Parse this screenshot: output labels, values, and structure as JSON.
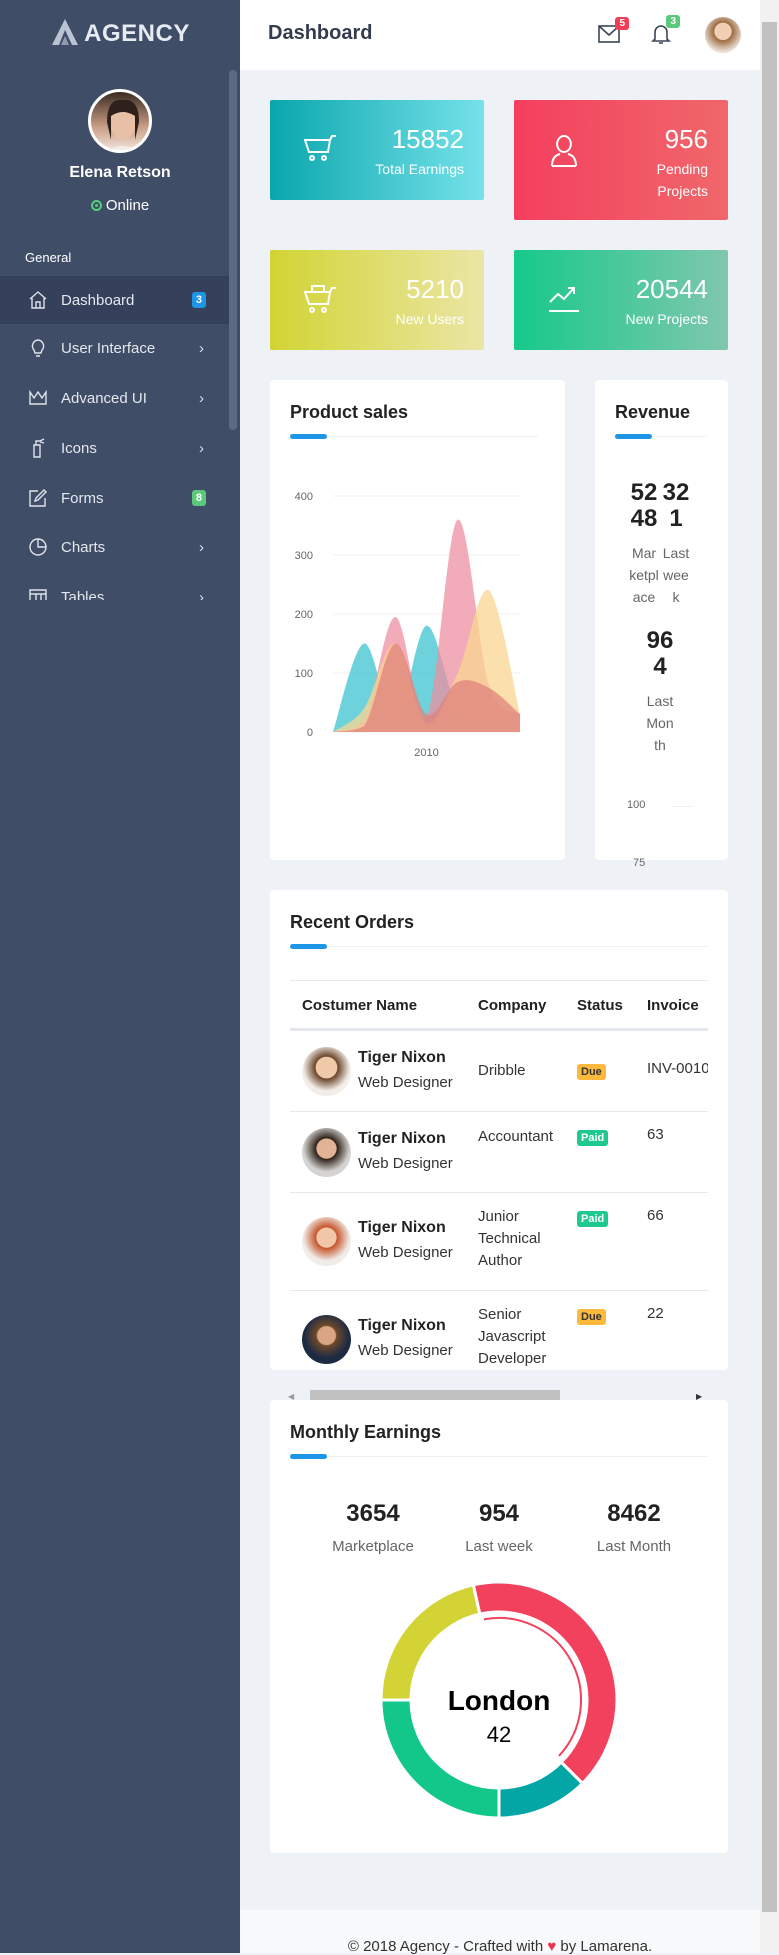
{
  "brand": {
    "name": "AGENCY"
  },
  "user": {
    "name": "Elena Retson",
    "status": "Online"
  },
  "sidebar": {
    "section": "General",
    "items": [
      {
        "label": "Dashboard",
        "icon": "home-icon",
        "badge": "3",
        "badge_color": "#1e96e8",
        "active": true
      },
      {
        "label": "User Interface",
        "icon": "lightbulb-icon"
      },
      {
        "label": "Advanced UI",
        "icon": "crown-icon"
      },
      {
        "label": "Icons",
        "icon": "extinguisher-icon"
      },
      {
        "label": "Forms",
        "icon": "edit-icon",
        "badge": "8",
        "badge_color": "#5bc97a"
      },
      {
        "label": "Charts",
        "icon": "pie-chart-icon"
      },
      {
        "label": "Tables",
        "icon": "table-icon"
      }
    ]
  },
  "header": {
    "title": "Dashboard",
    "mail_count": "5",
    "notification_count": "3",
    "mail_badge_color": "#f03d5a",
    "notif_badge_color": "#5bc97a"
  },
  "stats": [
    {
      "value": "15852",
      "label": "Total Earnings",
      "icon": "cart-icon",
      "gradient": [
        "#0aa6ad",
        "#76e2ea"
      ]
    },
    {
      "value": "956",
      "label": "Pending Projects",
      "icon": "user-icon",
      "gradient": [
        "#f43f5e",
        "#f0676a"
      ]
    },
    {
      "value": "5210",
      "label": "New Users",
      "icon": "basket-icon",
      "gradient": [
        "#d2d434",
        "#ebe6a6"
      ]
    },
    {
      "value": "20544",
      "label": "New Projects",
      "icon": "trend-icon",
      "gradient": [
        "#16c98a",
        "#80c7ae"
      ]
    }
  ],
  "product_sales": {
    "title": "Product sales"
  },
  "chart_data": {
    "type": "area",
    "x_label": "2010",
    "yticks": [
      0,
      100,
      200,
      300,
      400
    ],
    "ylim": [
      0,
      400
    ],
    "series": [
      {
        "color": "#3cc3d0",
        "values": [
          0,
          150,
          20,
          180,
          40,
          25,
          30
        ]
      },
      {
        "color": "#ee8fa1",
        "values": [
          0,
          20,
          195,
          25,
          360,
          80,
          30
        ]
      },
      {
        "color": "#f9d592",
        "values": [
          0,
          40,
          150,
          15,
          100,
          240,
          30
        ]
      },
      {
        "color": "#e0837c",
        "values": [
          0,
          10,
          150,
          30,
          85,
          75,
          30
        ]
      }
    ]
  },
  "revenue": {
    "title": "Revenue",
    "stats": [
      {
        "value": "5248",
        "label": "Marketplace"
      },
      {
        "value": "321",
        "label": "Last week"
      },
      {
        "value": "964",
        "label": "Last Month"
      }
    ],
    "axis": [
      "100",
      "75"
    ]
  },
  "orders": {
    "title": "Recent Orders",
    "columns": [
      "Costumer Name",
      "Company",
      "Status",
      "Invoice"
    ],
    "rows": [
      {
        "name": "Tiger Nixon",
        "role": "Web Designer",
        "company": "Dribble",
        "status": "Due",
        "invoice": "INV-0010"
      },
      {
        "name": "Tiger Nixon",
        "role": "Web Designer",
        "company": "Accountant",
        "status": "Paid",
        "invoice": "63"
      },
      {
        "name": "Tiger Nixon",
        "role": "Web Designer",
        "company": "Junior Technical Author",
        "status": "Paid",
        "invoice": "66"
      },
      {
        "name": "Tiger Nixon",
        "role": "Web Designer",
        "company": "Senior Javascript Developer",
        "status": "Due",
        "invoice": "22"
      }
    ],
    "status_colors": {
      "Due": "#fdb93b",
      "Paid": "#1ec98f"
    }
  },
  "monthly": {
    "title": "Monthly Earnings",
    "stats": [
      {
        "value": "3654",
        "label": "Marketplace"
      },
      {
        "value": "954",
        "label": "Last week"
      },
      {
        "value": "8462",
        "label": "Last Month"
      }
    ],
    "donut": {
      "center_label": "London",
      "center_value": "42",
      "segments": [
        {
          "color": "#f2415d",
          "percent": 41
        },
        {
          "color": "#04a5a5",
          "percent": 12.5
        },
        {
          "color": "#13c68a",
          "percent": 25
        },
        {
          "color": "#d3d335",
          "percent": 21.5
        }
      ]
    }
  },
  "footer": {
    "prefix": "© 2018 Agency - Crafted with",
    "suffix": "by Lamarena."
  }
}
